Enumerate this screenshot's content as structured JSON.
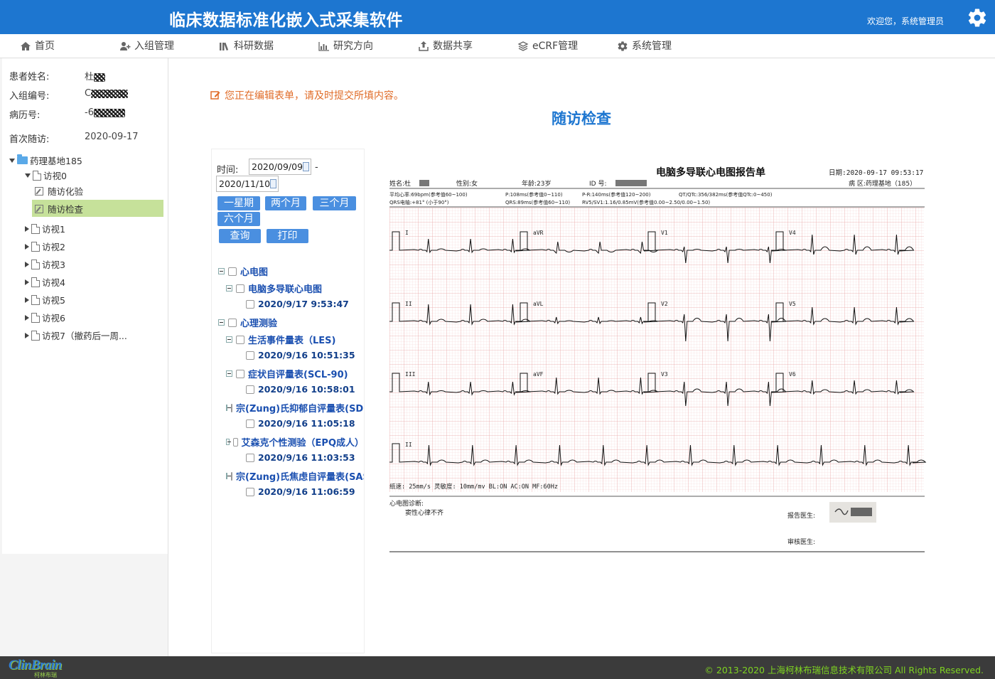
{
  "header": {
    "title": "临床数据标准化嵌入式采集软件",
    "welcome": "欢迎您，系统管理员"
  },
  "nav": [
    {
      "label": "首页",
      "icon": "home-icon"
    },
    {
      "label": "入组管理",
      "icon": "user-add-icon"
    },
    {
      "label": "科研数据",
      "icon": "books-icon"
    },
    {
      "label": "研究方向",
      "icon": "bar-chart-icon"
    },
    {
      "label": "数据共享",
      "icon": "share-icon"
    },
    {
      "label": "eCRF管理",
      "icon": "layers-icon"
    },
    {
      "label": "系统管理",
      "icon": "gear-icon"
    }
  ],
  "patient": {
    "name_label": "患者姓名:",
    "name_value": "杜",
    "enroll_label": "入组编号:",
    "enroll_value": "C",
    "record_label": "病历号:",
    "record_value": "-6",
    "first_visit_label": "首次随访:",
    "first_visit_value": "2020-09-17"
  },
  "tree": {
    "root": "药理基地185",
    "visit0": "访视0",
    "lab": "随访化验",
    "exam": "随访检查",
    "visits": [
      "访视1",
      "访视2",
      "访视3",
      "访视4",
      "访视5",
      "访视6",
      "访视7（撤药后一周..."
    ]
  },
  "main": {
    "notice": "您正在编辑表单，请及时提交所填内容。",
    "title": "随访检查"
  },
  "filter": {
    "time_label": "时间:",
    "date_from": "2020/09/09",
    "date_sep": "-",
    "date_to": "2020/11/10",
    "btn_week": "一星期",
    "btn_2m": "两个月",
    "btn_3m": "三个月",
    "btn_6m": "六个月",
    "btn_query": "查询",
    "btn_print": "打印"
  },
  "records": {
    "ecg": "心电图",
    "ecg_sub": "电脑多导联心电图",
    "ecg_t1": "2020/9/17 9:53:47",
    "psy": "心理测验",
    "les": "生活事件量表（LES)",
    "les_t": "2020/9/16 10:51:35",
    "scl": "症状自评量表(SCL-90)",
    "scl_t": "2020/9/16 10:58:01",
    "sds": "宗(Zung)氏抑郁自评量表(SDS)",
    "sds_t": "2020/9/16 11:05:18",
    "epq": "艾森克个性测验（EPQ成人）",
    "epq_t": "2020/9/16 11:03:53",
    "sas": "宗(Zung)氏焦虑自评量表(SAS)",
    "sas_t": "2020/9/16 11:06:59"
  },
  "ecg": {
    "title": "电脑多导联心电图报告单",
    "date": "日期:2020-09-17  09:53:17",
    "name": "姓名:杜",
    "sex": "性别:女",
    "age": "年龄:23岁",
    "id": "ID 号:",
    "ward": "病  区:药理基地（185）",
    "line1a": "平均心率:69bpm(参考值60~100)",
    "line1b": "P:108ms(参考值0~110)",
    "line1c": "P-R:140ms(参考值120~200)",
    "line1d": "QT/QTc:356/382ms(参考值QTc:0~450)",
    "line2a": "QRS电轴:+81°  (小于90°)",
    "line2b": "QRS:89ms(参考值60~110)",
    "line2c": "RV5/SV1:1.16/0.85mV(参考值0.00~2.50/0.00~1.50)",
    "leads": [
      "I",
      "aVR",
      "V1",
      "V4",
      "II",
      "aVL",
      "V2",
      "V5",
      "III",
      "aVF",
      "V3",
      "V6",
      "II"
    ],
    "paper": "纸速: 25mm/s 灵敏度: 10mm/mv BL:ON AC:ON MF:60Hz",
    "diag_label": "心电图诊断:",
    "diag": "窦性心律不齐",
    "doctor_label": "报告医生:",
    "reviewer_label": "审核医生:",
    "colors": {
      "grid_minor": "#f3cccc",
      "grid_major": "#e6a0a0",
      "trace": "#111111"
    }
  },
  "footer": {
    "copyright": "© 2013-2020 上海柯林布瑞信息技术有限公司 All Rights Reserved.",
    "logo": "ClinBrain",
    "logo_sub": "柯林布瑞"
  }
}
